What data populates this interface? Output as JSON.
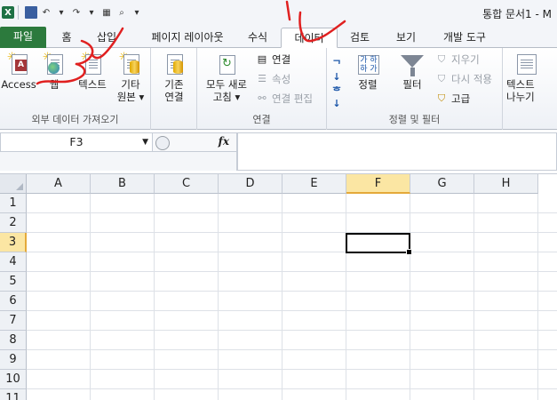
{
  "window": {
    "title": "통합 문서1 - M",
    "qat": {
      "app_logo": "X",
      "icons": [
        "excel-logo-icon",
        "save-icon",
        "undo-icon",
        "redo-icon",
        "chart-icon",
        "print-preview-icon",
        "customize-dropdown-icon"
      ]
    }
  },
  "tabs": [
    {
      "label": "파일",
      "active": false
    },
    {
      "label": "홈",
      "active": false
    },
    {
      "label": "삽입",
      "active": false
    },
    {
      "label": "페이지 레이아웃",
      "active": false
    },
    {
      "label": "수식",
      "active": false
    },
    {
      "label": "데이터",
      "active": true
    },
    {
      "label": "검토",
      "active": false
    },
    {
      "label": "보기",
      "active": false
    },
    {
      "label": "개발 도구",
      "active": false
    }
  ],
  "ribbon": {
    "external_data": {
      "label": "외부 데이터 가져오기",
      "access": "Access",
      "web": "웹",
      "text": "텍스트",
      "other_line1": "기타",
      "other_line2": "원본 ▾"
    },
    "existing": {
      "line1": "기존",
      "line2": "연결"
    },
    "connections": {
      "label": "연결",
      "refresh_line1": "모두 새로",
      "refresh_line2": "고침 ▾",
      "connections": "연결",
      "properties": "속성",
      "edit_links": "연결 편집"
    },
    "sort_filter": {
      "label": "정렬 및 필터",
      "sort": "정렬",
      "filter": "필터",
      "clear": "지우기",
      "reapply": "다시 적용",
      "advanced": "고급",
      "sort_icon_text": "가 하\n하 가"
    },
    "data_tools": {
      "text_to_cols_line1": "텍스트",
      "text_to_cols_line2": "나누기"
    }
  },
  "formula_bar": {
    "name_box": "F3",
    "fx_label": "fx",
    "formula": ""
  },
  "sheet": {
    "columns": [
      "A",
      "B",
      "C",
      "D",
      "E",
      "F",
      "G",
      "H"
    ],
    "rows": [
      "1",
      "2",
      "3",
      "4",
      "5",
      "6",
      "7",
      "8",
      "9",
      "10",
      "11"
    ],
    "selected_column": "F",
    "selected_row": "3"
  },
  "colors": {
    "file_tab": "#2c7a3d",
    "selection_header": "#fbe6a3",
    "annotation": "#e02020"
  }
}
